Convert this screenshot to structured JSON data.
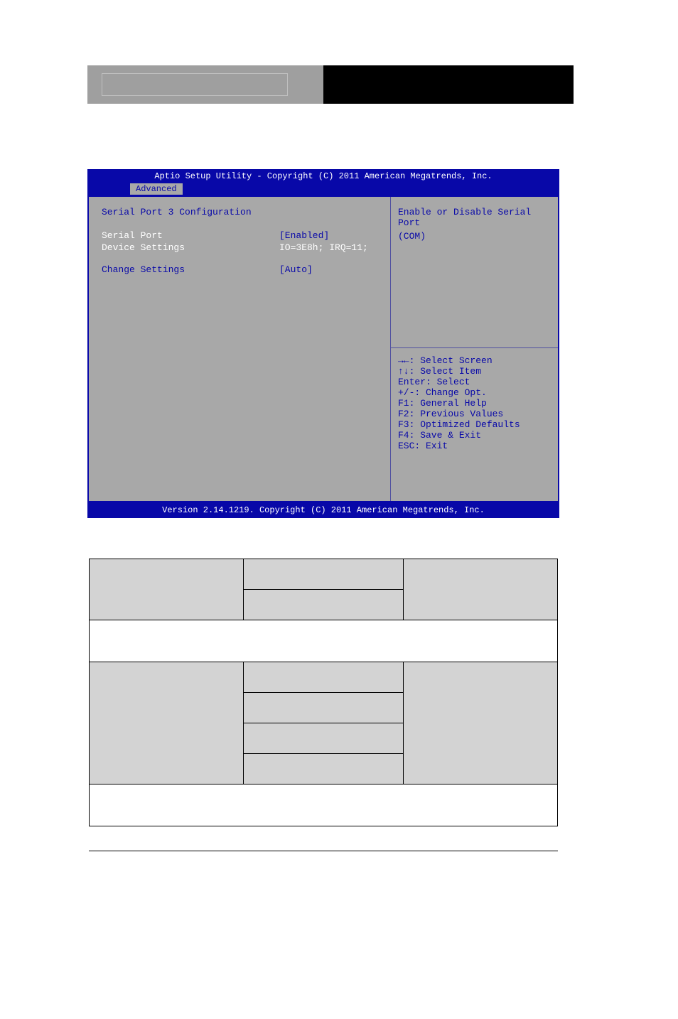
{
  "bios": {
    "title": "Aptio Setup Utility - Copyright (C) 2011 American Megatrends, Inc.",
    "tab": "Advanced",
    "heading": "Serial Port 3 Configuration",
    "serial_port_label": "Serial Port",
    "serial_port_value": "[Enabled]",
    "device_settings_label": "Device Settings",
    "device_settings_value": "IO=3E8h; IRQ=11;",
    "change_settings_label": "Change Settings",
    "change_settings_value": "[Auto]",
    "help": {
      "l0": "Enable or Disable Serial Port",
      "l1": "(COM)"
    },
    "keys": {
      "k0": "→←: Select Screen",
      "k1": "↑↓: Select Item",
      "k2": "Enter: Select",
      "k3": "+/-: Change Opt.",
      "k4": "F1: General Help",
      "k5": "F2: Previous Values",
      "k6": "F3: Optimized Defaults",
      "k7": "F4: Save & Exit",
      "k8": "ESC: Exit"
    },
    "footer": "Version 2.14.1219. Copyright (C) 2011 American Megatrends, Inc."
  }
}
